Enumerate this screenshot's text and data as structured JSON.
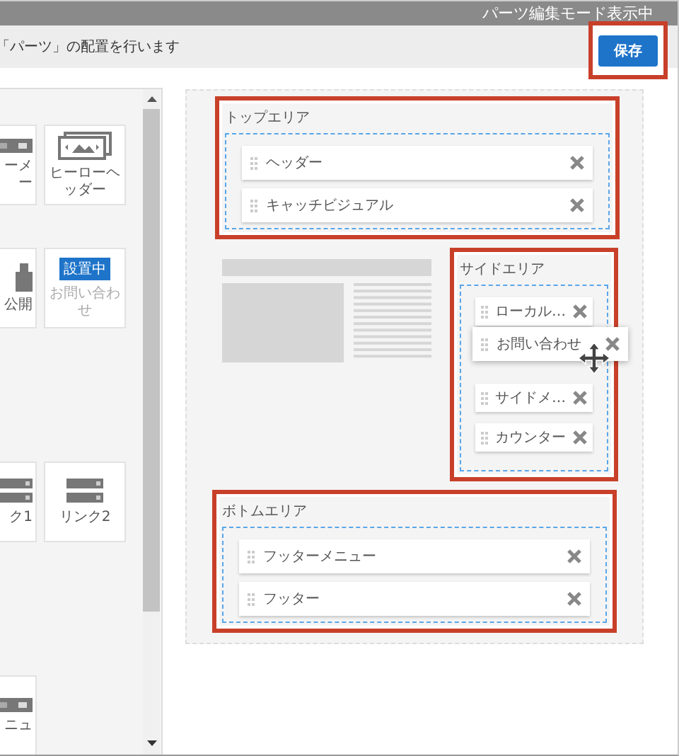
{
  "status_bar": {
    "text": "パーツ編集モード表示中"
  },
  "header": {
    "instruction": "「パーツ」の配置を行います",
    "save_button": {
      "label": "保存",
      "highlighted": true
    }
  },
  "palette": {
    "rows": [
      [
        {
          "kind": "bar",
          "label": "ーメー",
          "disabled": false
        },
        {
          "kind": "hero",
          "label": "ヒーローヘッダー",
          "disabled": false
        }
      ],
      [
        {
          "kind": "block",
          "label": "公開",
          "disabled": false
        },
        {
          "kind": "status",
          "badge": "設置中",
          "label": "お問い合わせ",
          "disabled": true
        }
      ],
      [
        {
          "kind": "links",
          "label": "ク1",
          "disabled": false
        },
        {
          "kind": "links",
          "label": "リンク2",
          "disabled": false
        }
      ],
      [
        {
          "kind": "bar",
          "label": "ニュ",
          "disabled": false
        }
      ]
    ]
  },
  "canvas": {
    "top_area": {
      "title": "トップエリア",
      "highlighted": true,
      "items": [
        {
          "kind": "part",
          "label": "ヘッダー"
        },
        {
          "kind": "part",
          "label": "キャッチビジュアル"
        }
      ]
    },
    "side_area": {
      "title": "サイドエリア",
      "highlighted": true,
      "items": [
        {
          "kind": "part",
          "label": "ローカル…"
        },
        {
          "kind": "drop-space"
        },
        {
          "kind": "part",
          "label": "サイドメ…"
        },
        {
          "kind": "part",
          "label": "カウンター"
        }
      ]
    },
    "bottom_area": {
      "title": "ボトムエリア",
      "highlighted": true,
      "items": [
        {
          "kind": "part",
          "label": "フッターメニュー"
        },
        {
          "kind": "part",
          "label": "フッター"
        }
      ]
    },
    "dragging": {
      "label": "お問い合わせ"
    }
  }
}
